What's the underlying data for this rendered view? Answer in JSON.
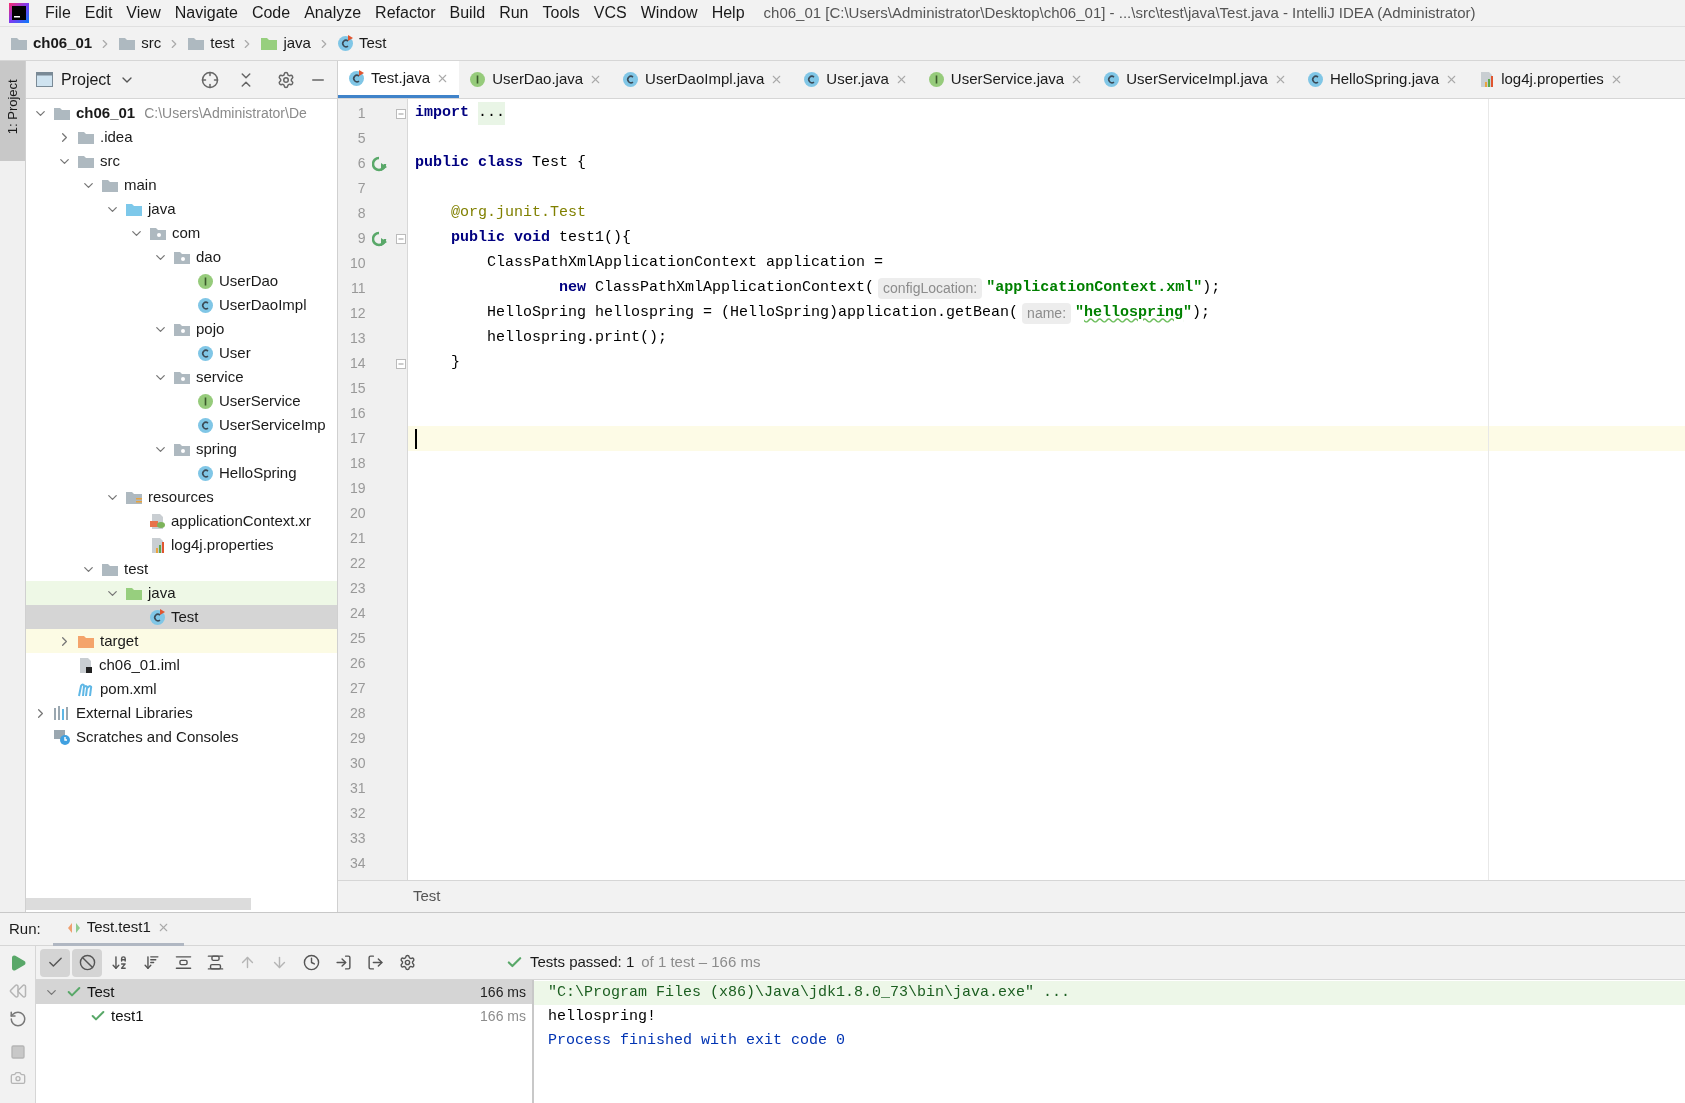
{
  "window": {
    "title": "ch06_01 [C:\\Users\\Administrator\\Desktop\\ch06_01] - ...\\src\\test\\java\\Test.java - IntelliJ IDEA (Administrator)"
  },
  "menu": [
    "File",
    "Edit",
    "View",
    "Navigate",
    "Code",
    "Analyze",
    "Refactor",
    "Build",
    "Run",
    "Tools",
    "VCS",
    "Window",
    "Help"
  ],
  "breadcrumb": [
    {
      "label": "ch06_01",
      "kind": "module"
    },
    {
      "label": "src",
      "kind": "folder"
    },
    {
      "label": "test",
      "kind": "folder"
    },
    {
      "label": "java",
      "kind": "test-source"
    },
    {
      "label": "Test",
      "kind": "test-class"
    }
  ],
  "side_tab": {
    "label": "1: Project",
    "selected": true
  },
  "project": {
    "title": "Project",
    "tree": [
      {
        "label": "ch06_01",
        "path": "C:\\Users\\Administrator\\De",
        "kind": "module",
        "expanded": true,
        "selected": false,
        "children": [
          {
            "label": ".idea",
            "kind": "folder",
            "expanded": false,
            "selected": false
          },
          {
            "label": "src",
            "kind": "folder",
            "expanded": true,
            "selected": false,
            "children": [
              {
                "label": "main",
                "kind": "folder",
                "expanded": true,
                "selected": false,
                "children": [
                  {
                    "label": "java",
                    "kind": "source",
                    "expanded": true,
                    "selected": false,
                    "children": [
                      {
                        "label": "com",
                        "kind": "package",
                        "expanded": true,
                        "selected": false,
                        "children": [
                          {
                            "label": "dao",
                            "kind": "package",
                            "expanded": true,
                            "selected": false,
                            "children": [
                              {
                                "label": "UserDao",
                                "kind": "interface",
                                "selected": false
                              },
                              {
                                "label": "UserDaoImpl",
                                "kind": "class",
                                "selected": false
                              }
                            ]
                          },
                          {
                            "label": "pojo",
                            "kind": "package",
                            "expanded": true,
                            "selected": false,
                            "children": [
                              {
                                "label": "User",
                                "kind": "class",
                                "selected": false
                              }
                            ]
                          },
                          {
                            "label": "service",
                            "kind": "package",
                            "expanded": true,
                            "selected": false,
                            "children": [
                              {
                                "label": "UserService",
                                "kind": "interface",
                                "selected": false
                              },
                              {
                                "label": "UserServiceImp",
                                "kind": "class",
                                "selected": false
                              }
                            ]
                          },
                          {
                            "label": "spring",
                            "kind": "package",
                            "expanded": true,
                            "selected": false,
                            "children": [
                              {
                                "label": "HelloSpring",
                                "kind": "class",
                                "selected": false
                              }
                            ]
                          }
                        ]
                      }
                    ]
                  },
                  {
                    "label": "resources",
                    "kind": "resources",
                    "expanded": true,
                    "selected": false,
                    "children": [
                      {
                        "label": "applicationContext.xr",
                        "kind": "spring-xml",
                        "selected": false
                      },
                      {
                        "label": "log4j.properties",
                        "kind": "properties",
                        "selected": false
                      }
                    ]
                  }
                ]
              },
              {
                "label": "test",
                "kind": "folder",
                "expanded": true,
                "selected": false,
                "children": [
                  {
                    "label": "java",
                    "kind": "test-source",
                    "expanded": true,
                    "selected": false,
                    "children": [
                      {
                        "label": "Test",
                        "kind": "test-class",
                        "selected": true
                      }
                    ]
                  }
                ]
              }
            ]
          },
          {
            "label": "target",
            "kind": "excluded",
            "expanded": false,
            "selected": false
          },
          {
            "label": "ch06_01.iml",
            "kind": "iml",
            "selected": false
          },
          {
            "label": "pom.xml",
            "kind": "maven",
            "selected": false
          }
        ]
      },
      {
        "label": "External Libraries",
        "kind": "libraries",
        "expanded": false,
        "selected": false
      },
      {
        "label": "Scratches and Consoles",
        "kind": "scratches",
        "selected": false
      }
    ]
  },
  "tabs": [
    {
      "label": "Test.java",
      "kind": "test-class",
      "selected": true
    },
    {
      "label": "UserDao.java",
      "kind": "interface",
      "selected": false
    },
    {
      "label": "UserDaoImpl.java",
      "kind": "class",
      "selected": false
    },
    {
      "label": "User.java",
      "kind": "class",
      "selected": false
    },
    {
      "label": "UserService.java",
      "kind": "interface",
      "selected": false
    },
    {
      "label": "UserServiceImpl.java",
      "kind": "class",
      "selected": false
    },
    {
      "label": "HelloSpring.java",
      "kind": "class",
      "selected": false
    },
    {
      "label": "log4j.properties",
      "kind": "properties",
      "selected": false
    }
  ],
  "code": [
    {
      "number": "1",
      "fold": true,
      "run": false,
      "current": false,
      "tokens": [
        {
          "kind": "keyword",
          "text": "import"
        },
        {
          "kind": "folded",
          "text": "..."
        }
      ]
    },
    {
      "number": "5",
      "fold": false,
      "run": false,
      "current": false
    },
    {
      "number": "6",
      "fold": false,
      "run": true,
      "current": false,
      "tokens": [
        {
          "kind": "keyword",
          "text": "public class"
        },
        {
          "kind": "plain",
          "text": " Test {"
        }
      ]
    },
    {
      "number": "7",
      "fold": false,
      "run": false,
      "current": false
    },
    {
      "number": "8",
      "fold": false,
      "run": false,
      "current": false,
      "tokens": [
        {
          "kind": "annotation",
          "text": "    @org.junit."
        },
        {
          "kind": "annotation-name",
          "text": "Test"
        }
      ]
    },
    {
      "number": "9",
      "fold": true,
      "run": true,
      "current": false,
      "tokens": [
        {
          "kind": "keyword",
          "text": "    public void"
        },
        {
          "kind": "plain",
          "text": " test1(){"
        }
      ]
    },
    {
      "number": "10",
      "fold": false,
      "run": false,
      "current": false,
      "tokens": [
        {
          "kind": "plain",
          "text": "        ClassPathXmlApplicationContext application ="
        }
      ]
    },
    {
      "number": "11",
      "fold": false,
      "run": false,
      "current": false,
      "tokens": [
        {
          "kind": "keyword",
          "text": "                new"
        },
        {
          "kind": "plain",
          "text": " ClassPathXmlApplicationContext("
        },
        {
          "kind": "hint",
          "text": "configLocation:"
        },
        {
          "kind": "string",
          "text": "\"applicationContext.xml\""
        },
        {
          "kind": "plain",
          "text": ");"
        }
      ]
    },
    {
      "number": "12",
      "fold": false,
      "run": false,
      "current": false,
      "tokens": [
        {
          "kind": "plain",
          "text": "        HelloSpring hellospring = (HelloSpring)application.getBean("
        },
        {
          "kind": "hint",
          "text": "name:"
        },
        {
          "kind": "string",
          "text": "\""
        },
        {
          "kind": "string-typo",
          "text": "hellospring"
        },
        {
          "kind": "string",
          "text": "\""
        },
        {
          "kind": "plain",
          "text": ");"
        }
      ]
    },
    {
      "number": "13",
      "fold": false,
      "run": false,
      "current": false,
      "tokens": [
        {
          "kind": "plain",
          "text": "        hellospring.print();"
        }
      ]
    },
    {
      "number": "14",
      "fold": true,
      "run": false,
      "current": false,
      "tokens": [
        {
          "kind": "plain",
          "text": "    }"
        }
      ]
    },
    {
      "number": "15",
      "fold": false,
      "run": false,
      "current": false
    },
    {
      "number": "16",
      "fold": false,
      "run": false,
      "current": false
    },
    {
      "number": "17",
      "fold": false,
      "run": false,
      "current": true
    },
    {
      "number": "18",
      "fold": false,
      "run": false,
      "current": false
    },
    {
      "number": "19",
      "fold": false,
      "run": false,
      "current": false
    },
    {
      "number": "20",
      "fold": false,
      "run": false,
      "current": false
    },
    {
      "number": "21",
      "fold": false,
      "run": false,
      "current": false
    },
    {
      "number": "22",
      "fold": false,
      "run": false,
      "current": false
    },
    {
      "number": "23",
      "fold": false,
      "run": false,
      "current": false
    },
    {
      "number": "24",
      "fold": false,
      "run": false,
      "current": false
    },
    {
      "number": "25",
      "fold": false,
      "run": false,
      "current": false
    },
    {
      "number": "26",
      "fold": false,
      "run": false,
      "current": false
    },
    {
      "number": "27",
      "fold": false,
      "run": false,
      "current": false
    },
    {
      "number": "28",
      "fold": false,
      "run": false,
      "current": false
    },
    {
      "number": "29",
      "fold": false,
      "run": false,
      "current": false
    },
    {
      "number": "30",
      "fold": false,
      "run": false,
      "current": false
    },
    {
      "number": "31",
      "fold": false,
      "run": false,
      "current": false
    },
    {
      "number": "32",
      "fold": false,
      "run": false,
      "current": false
    },
    {
      "number": "33",
      "fold": false,
      "run": false,
      "current": false
    },
    {
      "number": "34",
      "fold": false,
      "run": false,
      "current": false
    }
  ],
  "editor_breadcrumb": "Test",
  "run": {
    "label": "Run:",
    "tab": "Test.test1",
    "status": {
      "passed": "Tests passed: 1",
      "detail": "of 1 test – 166 ms"
    },
    "tests": [
      {
        "label": "Test",
        "time": "166 ms",
        "expanded": true,
        "selected": true,
        "children": [
          {
            "label": "test1",
            "time": "166 ms",
            "selected": false
          }
        ]
      }
    ],
    "console": [
      {
        "kind": "command",
        "text": "\"C:\\Program Files (x86)\\Java\\jdk1.8.0_73\\bin\\java.exe\" ..."
      },
      {
        "kind": "output",
        "text": "hellospring!"
      },
      {
        "kind": "system",
        "text": "Process finished with exit code 0"
      }
    ]
  }
}
